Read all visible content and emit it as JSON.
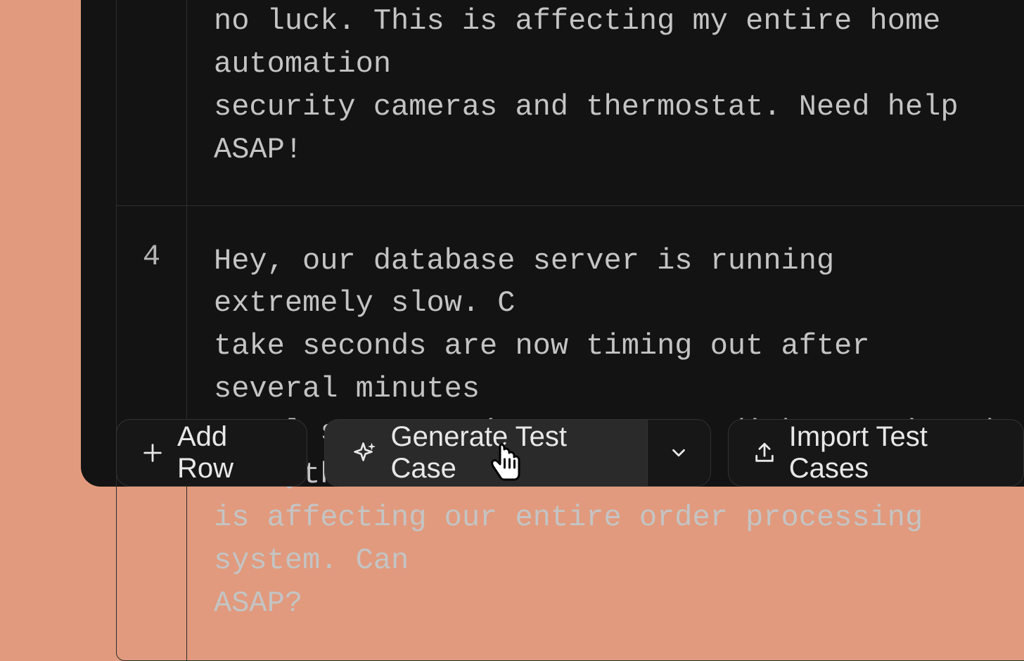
{
  "rows": [
    {
      "num": "",
      "text": "no luck. This is affecting my entire home automation\nsecurity cameras and thermostat. Need help ASAP!"
    },
    {
      "num": "4",
      "text": "Hey, our database server is running extremely slow. C\ntake seconds are now timing out after several minutes\nusual suspects (CPU, memory, disk space) and everythi\nis affecting our entire order processing system. Can \nASAP?"
    }
  ],
  "toolbar": {
    "add_row": "Add Row",
    "generate": "Generate Test Case",
    "import": "Import Test Cases"
  }
}
